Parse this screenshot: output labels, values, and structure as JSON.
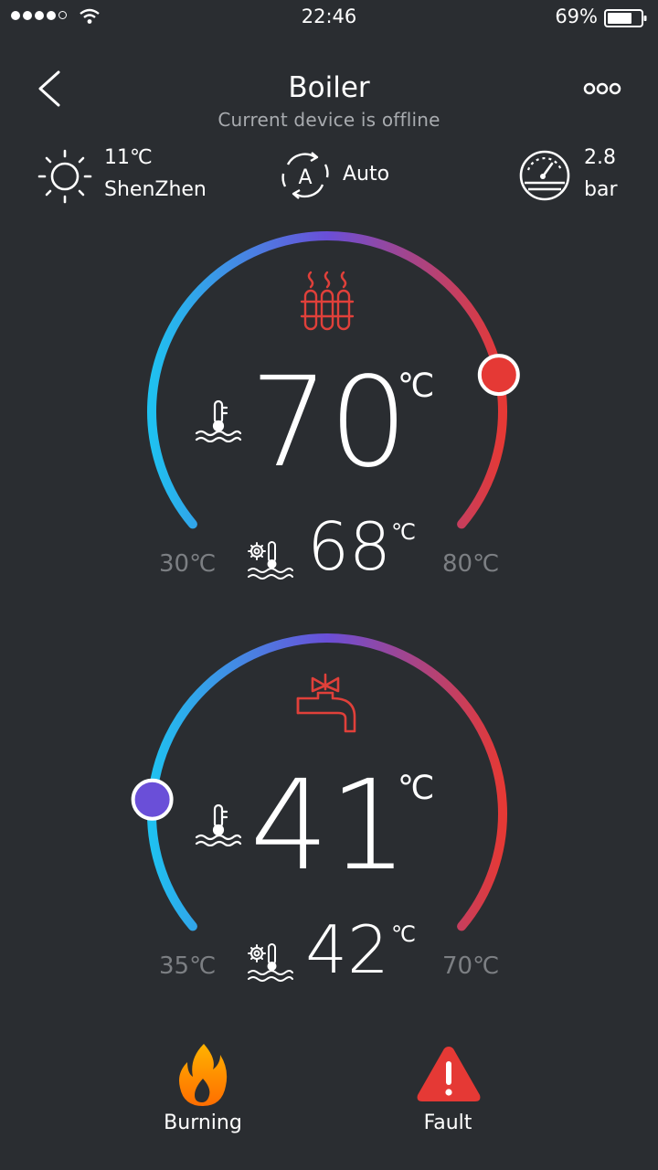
{
  "status_bar": {
    "time": "22:46",
    "battery_percent": "69%",
    "icons": [
      "signal-dots",
      "wifi-icon",
      "battery-icon"
    ]
  },
  "header": {
    "title": "Boiler",
    "subtitle": "Current device is offline",
    "back_icon": "chevron-left-icon",
    "menu_icon": "more-dots-icon"
  },
  "info": {
    "weather_temp": "11℃",
    "city": "ShenZhen",
    "mode": "Auto",
    "pressure_value": "2.8",
    "pressure_unit": "bar"
  },
  "heating": {
    "icon": "radiator-icon",
    "setpoint": "70",
    "unit": "℃",
    "actual": "68",
    "min_label": "30℃",
    "max_label": "80℃",
    "min": 30,
    "max": 80,
    "value": 70,
    "knob_color": "#e53935"
  },
  "hot_water": {
    "icon": "faucet-icon",
    "setpoint": "41",
    "unit": "℃",
    "actual": "42",
    "min_label": "35℃",
    "max_label": "70℃",
    "min": 35,
    "max": 70,
    "value": 41,
    "knob_color": "#6a4fd8"
  },
  "footer": {
    "burning_label": "Burning",
    "fault_label": "Fault"
  },
  "colors": {
    "background": "#2a2d31",
    "arc_cold": "#1fc1f0",
    "arc_mid": "#6a4fd8",
    "arc_hot": "#e53935",
    "flame": "#ff8a00",
    "fault": "#e53935"
  }
}
